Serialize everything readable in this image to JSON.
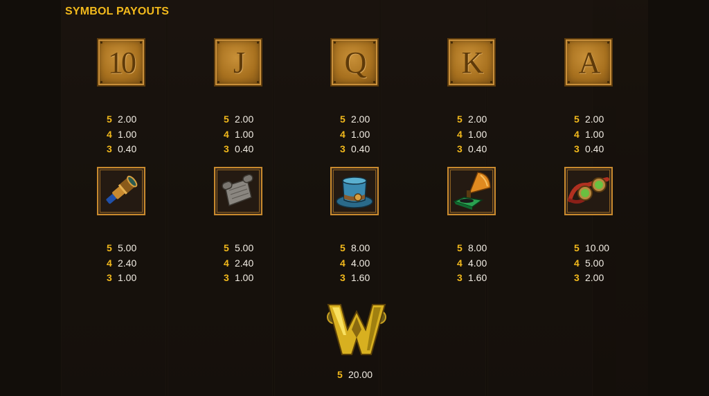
{
  "title": "SYMBOL PAYOUTS",
  "symbols": [
    {
      "kind": "card",
      "label": "10",
      "icon": "card-10-icon",
      "pays": [
        {
          "count": "5",
          "value": "2.00"
        },
        {
          "count": "4",
          "value": "1.00"
        },
        {
          "count": "3",
          "value": "0.40"
        }
      ]
    },
    {
      "kind": "card",
      "label": "J",
      "icon": "card-j-icon",
      "pays": [
        {
          "count": "5",
          "value": "2.00"
        },
        {
          "count": "4",
          "value": "1.00"
        },
        {
          "count": "3",
          "value": "0.40"
        }
      ]
    },
    {
      "kind": "card",
      "label": "Q",
      "icon": "card-q-icon",
      "pays": [
        {
          "count": "5",
          "value": "2.00"
        },
        {
          "count": "4",
          "value": "1.00"
        },
        {
          "count": "3",
          "value": "0.40"
        }
      ]
    },
    {
      "kind": "card",
      "label": "K",
      "icon": "card-k-icon",
      "pays": [
        {
          "count": "5",
          "value": "2.00"
        },
        {
          "count": "4",
          "value": "1.00"
        },
        {
          "count": "3",
          "value": "0.40"
        }
      ]
    },
    {
      "kind": "card",
      "label": "A",
      "icon": "card-a-icon",
      "pays": [
        {
          "count": "5",
          "value": "2.00"
        },
        {
          "count": "4",
          "value": "1.00"
        },
        {
          "count": "3",
          "value": "0.40"
        }
      ]
    },
    {
      "kind": "picture",
      "icon": "telescope-icon",
      "pays": [
        {
          "count": "5",
          "value": "5.00"
        },
        {
          "count": "4",
          "value": "2.40"
        },
        {
          "count": "3",
          "value": "1.00"
        }
      ]
    },
    {
      "kind": "picture",
      "icon": "scroll-icon",
      "pays": [
        {
          "count": "5",
          "value": "5.00"
        },
        {
          "count": "4",
          "value": "2.40"
        },
        {
          "count": "3",
          "value": "1.00"
        }
      ]
    },
    {
      "kind": "picture",
      "icon": "top-hat-icon",
      "pays": [
        {
          "count": "5",
          "value": "8.00"
        },
        {
          "count": "4",
          "value": "4.00"
        },
        {
          "count": "3",
          "value": "1.60"
        }
      ]
    },
    {
      "kind": "picture",
      "icon": "gramophone-icon",
      "pays": [
        {
          "count": "5",
          "value": "8.00"
        },
        {
          "count": "4",
          "value": "4.00"
        },
        {
          "count": "3",
          "value": "1.60"
        }
      ]
    },
    {
      "kind": "picture",
      "icon": "goggles-icon",
      "pays": [
        {
          "count": "5",
          "value": "10.00"
        },
        {
          "count": "4",
          "value": "5.00"
        },
        {
          "count": "3",
          "value": "2.00"
        }
      ]
    }
  ],
  "wild": {
    "icon": "wild-w-icon",
    "pays": [
      {
        "count": "5",
        "value": "20.00"
      }
    ]
  },
  "colors": {
    "accent": "#f2b91c",
    "text": "#f2ede4",
    "card_gold": "#b57a25",
    "frame": "#c98a2e"
  }
}
